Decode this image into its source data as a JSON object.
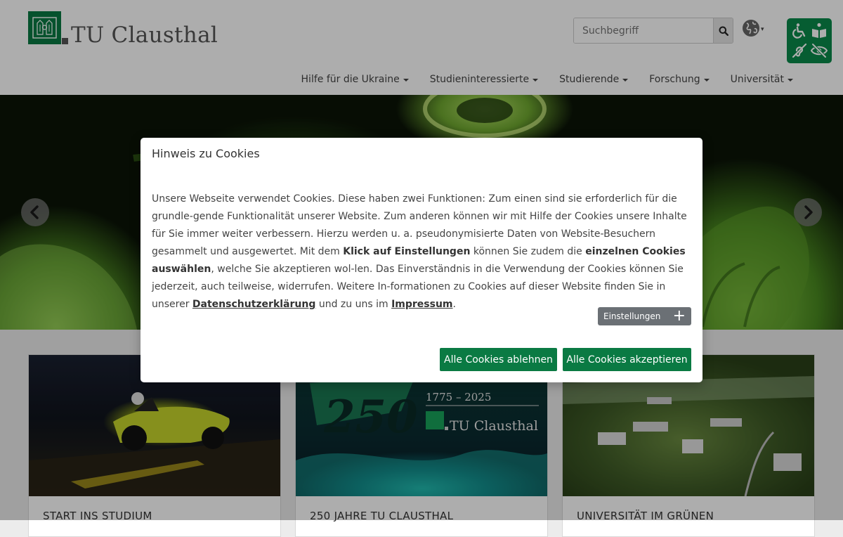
{
  "header": {
    "logo_text": "TU Clausthal",
    "search_placeholder": "Suchbegriff",
    "nav": [
      {
        "label": "Hilfe für die Ukraine"
      },
      {
        "label": "Studieninteressierte"
      },
      {
        "label": "Studierende"
      },
      {
        "label": "Forschung"
      },
      {
        "label": "Universität"
      }
    ]
  },
  "cards": [
    {
      "title": "START INS STUDIUM"
    },
    {
      "title": "250 JAHRE TU CLAUSTHAL",
      "image_years": "1775 – 2025",
      "image_number": "250",
      "image_brand": "TU Clausthal"
    },
    {
      "title": "UNIVERSITÄT IM GRÜNEN"
    }
  ],
  "cookie_modal": {
    "title": "Hinweis zu Cookies",
    "text_1": "Unsere Webseite verwendet Cookies. Diese haben zwei Funktionen: Zum einen sind sie erforderlich für die grundle-gende Funktionalität unserer Website. Zum anderen können wir mit Hilfe der Cookies unsere Inhalte für Sie immer weiter verbessern. Hierzu werden u. a. pseudonymisierte Daten von Website-Besuchern gesammelt und ausgewertet. Mit dem ",
    "bold_1": "Klick auf Einstellungen",
    "text_2": " können Sie zudem die ",
    "bold_2": "einzelnen Cookies auswählen",
    "text_3": ", welche Sie akzeptieren wol-len. Das Einverständnis in die Verwendung der Cookies können Sie jederzeit, auch teilweise, widerrufen. Weitere In-formationen zu Cookies auf dieser Website finden Sie in unserer ",
    "link_privacy": "Datenschutzerklärung",
    "text_4": " und zu uns im ",
    "link_imprint": "Impressum",
    "text_5": ".",
    "settings_label": "Einstellungen",
    "decline_label": "Alle Cookies ablehnen",
    "accept_label": "Alle Cookies akzeptieren"
  },
  "colors": {
    "brand_green": "#0a7a43",
    "settings_gray": "#6b7075"
  },
  "icons": {
    "search": "search-icon",
    "language": "globe-icon",
    "accessibility": [
      "wheelchair-icon",
      "book-reader-icon",
      "deaf-icon",
      "eye-slash-icon"
    ],
    "carousel_prev": "chevron-left-icon",
    "carousel_next": "chevron-right-icon",
    "settings_expand": "plus-icon"
  }
}
